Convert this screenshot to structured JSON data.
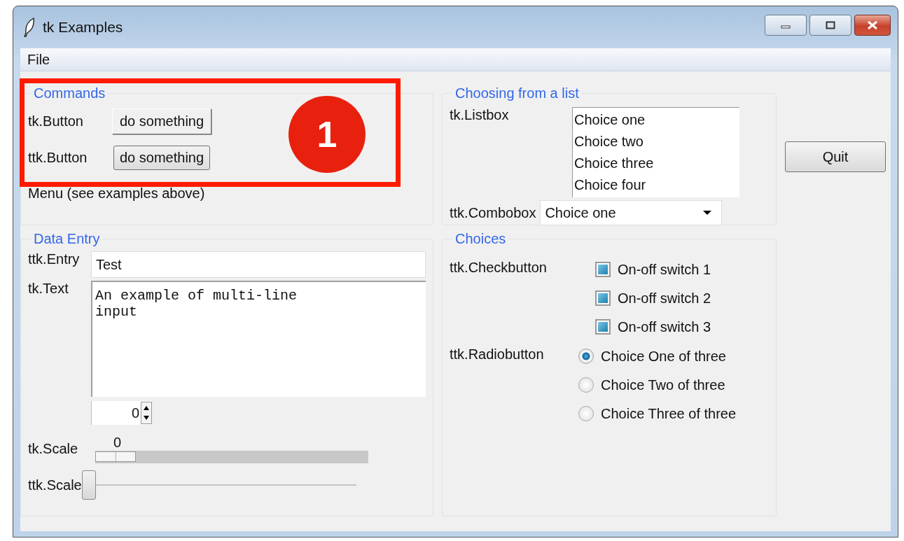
{
  "window": {
    "title": "tk Examples"
  },
  "menu": [
    {
      "label": "File"
    }
  ],
  "commands": {
    "title": "Commands",
    "rows": [
      {
        "label": "tk.Button",
        "button": "do something",
        "kind": "tk"
      },
      {
        "label": "ttk.Button",
        "button": "do something",
        "kind": "ttk"
      }
    ],
    "note": "Menu (see examples above)"
  },
  "list_panel": {
    "title": "Choosing from a list",
    "listbox_label": "tk.Listbox",
    "listbox": [
      {
        "label": "Choice one",
        "selected": false
      },
      {
        "label": "Choice two",
        "selected": false
      },
      {
        "label": "Choice three",
        "selected": false
      },
      {
        "label": "Choice four",
        "selected": false
      }
    ],
    "combobox_label": "ttk.Combobox",
    "combobox_value": "Choice one"
  },
  "quit_button": "Quit",
  "data_entry": {
    "title": "Data Entry",
    "entry_label": "ttk.Entry",
    "entry_value": "Test",
    "text_label": "tk.Text",
    "text_value": "An example of multi-line\ninput",
    "spinbox_value": "0",
    "tk_scale": {
      "label": "tk.Scale",
      "reading": "0",
      "level": 0
    },
    "ttk_scale": {
      "label": "ttk.Scale",
      "level": 0
    }
  },
  "choices": {
    "title": "Choices",
    "check_label": "ttk.Checkbutton",
    "checks": [
      {
        "label": "On-off switch 1",
        "indeterminate": true
      },
      {
        "label": "On-off switch 2",
        "indeterminate": true
      },
      {
        "label": "On-off switch 3",
        "indeterminate": true
      }
    ],
    "radio_label": "ttk.Radiobutton",
    "radios": [
      {
        "label": "Choice One of three",
        "selected": true
      },
      {
        "label": "Choice Two of three",
        "selected": false
      },
      {
        "label": "Choice Three of three",
        "selected": false
      }
    ]
  },
  "callout": {
    "label": "1"
  }
}
